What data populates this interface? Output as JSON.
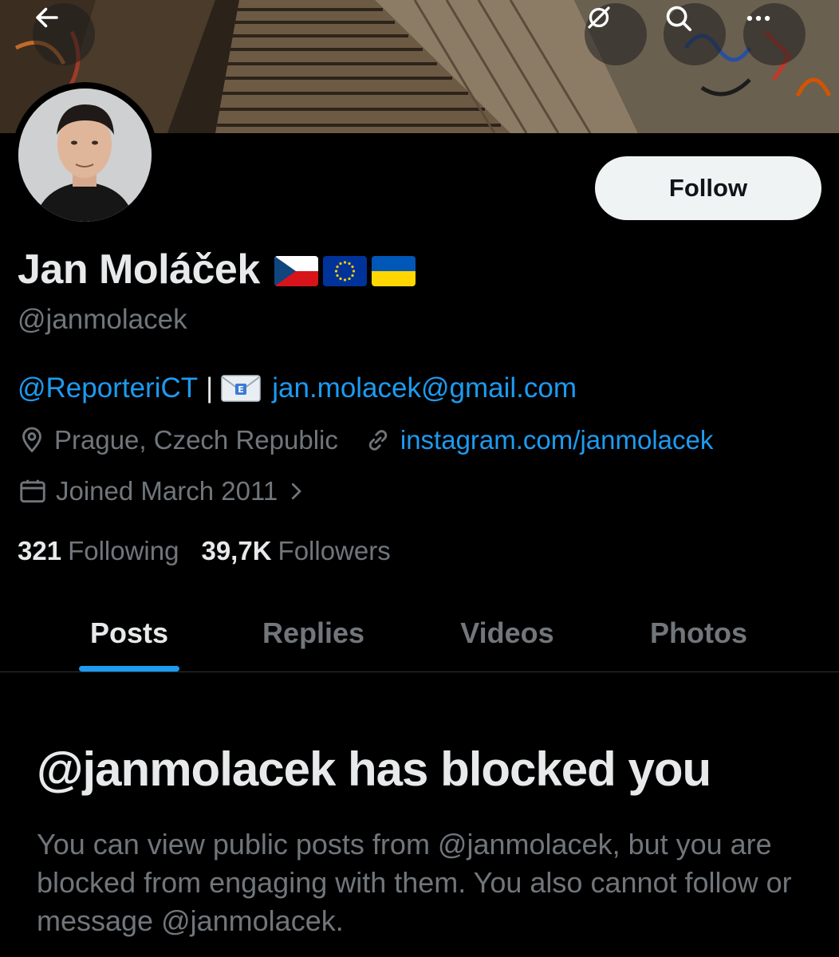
{
  "profile": {
    "name": "Jan Moláček",
    "handle": "@janmolacek",
    "flags": [
      "czech-flag",
      "eu-flag",
      "ukraine-flag"
    ],
    "bio_mention": "@ReporteriCT",
    "bio_separator": "|",
    "bio_email": "jan.molacek@gmail.com",
    "location": "Prague, Czech Republic",
    "website": "instagram.com/janmolacek",
    "joined": "Joined March 2011"
  },
  "stats": {
    "following_count": "321",
    "following_label": "Following",
    "followers_count": "39,7K",
    "followers_label": "Followers"
  },
  "actions": {
    "follow_label": "Follow"
  },
  "tabs": [
    {
      "label": "Posts",
      "active": true
    },
    {
      "label": "Replies",
      "active": false
    },
    {
      "label": "Videos",
      "active": false
    },
    {
      "label": "Photos",
      "active": false
    }
  ],
  "blocked": {
    "title": "@janmolacek has blocked you",
    "message": "You can view public posts from @janmolacek, but you are blocked from engaging with them. You also cannot follow or message @janmolacek."
  },
  "colors": {
    "accent": "#1d9bf0",
    "background": "#000000",
    "text_primary": "#e7e9ea",
    "text_secondary": "#71767b"
  }
}
